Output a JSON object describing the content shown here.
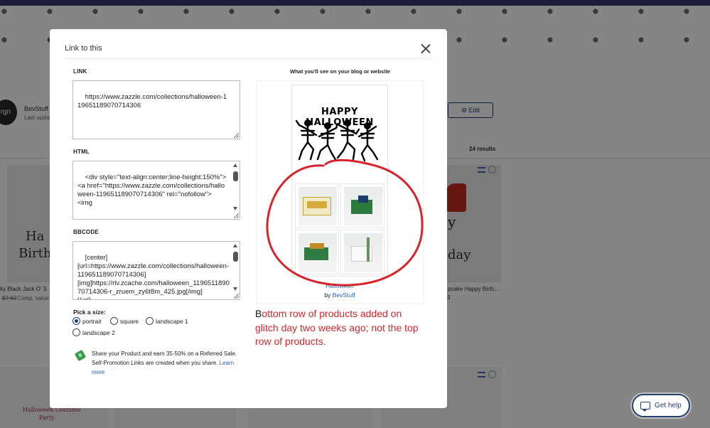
{
  "background": {
    "store_name": "BevStuff",
    "last_updated": "Last updat",
    "avatar_text": "rgn",
    "edit_label": "Edit",
    "results": "24 results",
    "card_left_title": "ky Black Jack O' S",
    "card_left_price_old": "$7.60",
    "card_left_price_note": "Comp. value",
    "card_right_title": "pcake Happy Birth...",
    "card_right_extra": "3",
    "happy_text": "y",
    "day_text": "day",
    "card_left_image_text": "Ha",
    "card_left_image_text2": "Birth",
    "costume_text": "Halloween Costume",
    "costume_sub": "Party"
  },
  "get_help": {
    "label": "Get help"
  },
  "modal": {
    "title": "Link to this",
    "link_label": "LINK",
    "link_value": "https://www.zazzle.com/collections/halloween-119651189070714306",
    "html_label": "HTML",
    "html_value": "<div style=\"text-align:center;line-height:150%\">\n<a href=\"https://www.zazzle.com/collections/halloween-119651189070714306\" rel=\"nofollow\">\n<img",
    "bbcode_label": "BBCODE",
    "bbcode_value": "[center]\n[url=https://www.zazzle.com/collections/halloween-119651189070714306]\n[img]https://rlv.zcache.com/halloween_119651189070714306-r_zruem_zy6t8m_425.jpg[/img]\n[/url]",
    "size_label": "Pick a size:",
    "sizes": [
      {
        "label": "portrait",
        "selected": true
      },
      {
        "label": "square",
        "selected": false
      },
      {
        "label": "landscape 1",
        "selected": false
      },
      {
        "label": "landscape 2",
        "selected": false
      }
    ],
    "promo_text": "Share your Product and earn 35-50% on a Referred Sale. Self-Promotion Links are created when you share.",
    "promo_link": "Learn more",
    "preview_heading": "What you'll see on your blog or website",
    "preview_title": "HAPPY HALLOWEEN",
    "preview_link": "Halloween",
    "preview_by_prefix": "by ",
    "preview_by_name": "BevStuff",
    "annotation_first": "B",
    "annotation_rest": "ottom row of products added on glitch day two weeks ago; not the top row of products."
  },
  "colors": {
    "annotation_red": "#d9232a",
    "link_blue": "#2a5db0",
    "help_navy": "#23426f"
  }
}
